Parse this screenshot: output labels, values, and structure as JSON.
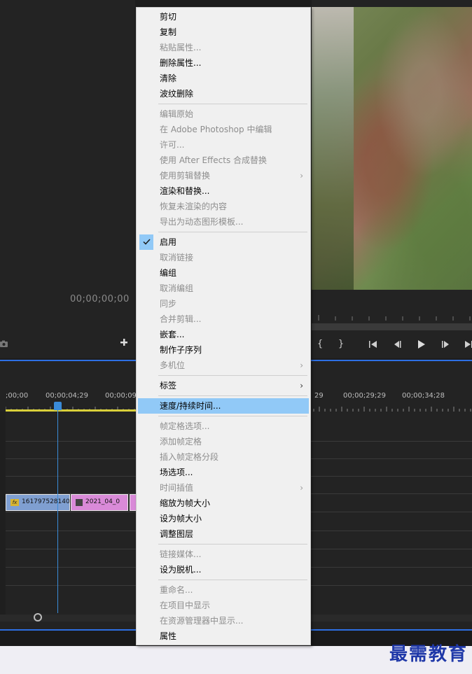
{
  "source_monitor": {
    "timecode": "00;00;00;00"
  },
  "timeline": {
    "ruler_labels": [
      ";00;00",
      "00;00;04;29",
      "00;00;09",
      "29",
      "00;00;29;29",
      "00;00;34;28"
    ],
    "clips": [
      {
        "label": "161797528140",
        "badge": "fx"
      },
      {
        "label": "2021_04_0",
        "badge": ""
      }
    ]
  },
  "transport_icons": [
    "mark-in-icon",
    "mark-out-icon",
    "go-to-in-icon",
    "step-back-icon",
    "play-icon",
    "step-forward-icon",
    "go-to-out-icon"
  ],
  "context_menu": {
    "items": [
      {
        "label": "剪切",
        "enabled": true
      },
      {
        "label": "复制",
        "enabled": true
      },
      {
        "label": "粘贴属性...",
        "enabled": false
      },
      {
        "label": "删除属性...",
        "enabled": true
      },
      {
        "label": "清除",
        "enabled": true
      },
      {
        "label": "波纹删除",
        "enabled": true
      },
      {
        "label": "编辑原始",
        "enabled": false
      },
      {
        "label": "在 Adobe Photoshop 中编辑",
        "enabled": false
      },
      {
        "label": "许可...",
        "enabled": false
      },
      {
        "label": "使用 After Effects 合成替换",
        "enabled": false
      },
      {
        "label": "使用剪辑替换",
        "enabled": false,
        "submenu": true
      },
      {
        "label": "渲染和替换...",
        "enabled": true
      },
      {
        "label": "恢复未渲染的内容",
        "enabled": false
      },
      {
        "label": "导出为动态图形模板...",
        "enabled": false
      },
      {
        "label": "启用",
        "enabled": true,
        "checked": true
      },
      {
        "label": "取消链接",
        "enabled": false
      },
      {
        "label": "编组",
        "enabled": true
      },
      {
        "label": "取消编组",
        "enabled": false
      },
      {
        "label": "同步",
        "enabled": false
      },
      {
        "label": "合并剪辑...",
        "enabled": false
      },
      {
        "label": "嵌套...",
        "enabled": true
      },
      {
        "label": "制作子序列",
        "enabled": true
      },
      {
        "label": "多机位",
        "enabled": false,
        "submenu": true
      },
      {
        "label": "标签",
        "enabled": true,
        "submenu": true
      },
      {
        "label": "速度/持续时间...",
        "enabled": true,
        "highlighted": true
      },
      {
        "label": "帧定格选项...",
        "enabled": false
      },
      {
        "label": "添加帧定格",
        "enabled": false
      },
      {
        "label": "插入帧定格分段",
        "enabled": false
      },
      {
        "label": "场选项...",
        "enabled": true
      },
      {
        "label": "时间插值",
        "enabled": false,
        "submenu": true
      },
      {
        "label": "缩放为帧大小",
        "enabled": true
      },
      {
        "label": "设为帧大小",
        "enabled": true
      },
      {
        "label": "调整图层",
        "enabled": true
      },
      {
        "label": "链接媒体...",
        "enabled": false
      },
      {
        "label": "设为脱机...",
        "enabled": true
      },
      {
        "label": "重命名...",
        "enabled": false
      },
      {
        "label": "在项目中显示",
        "enabled": false
      },
      {
        "label": "在资源管理器中显示...",
        "enabled": false
      },
      {
        "label": "属性",
        "enabled": true
      }
    ]
  },
  "watermark": "最需教育"
}
